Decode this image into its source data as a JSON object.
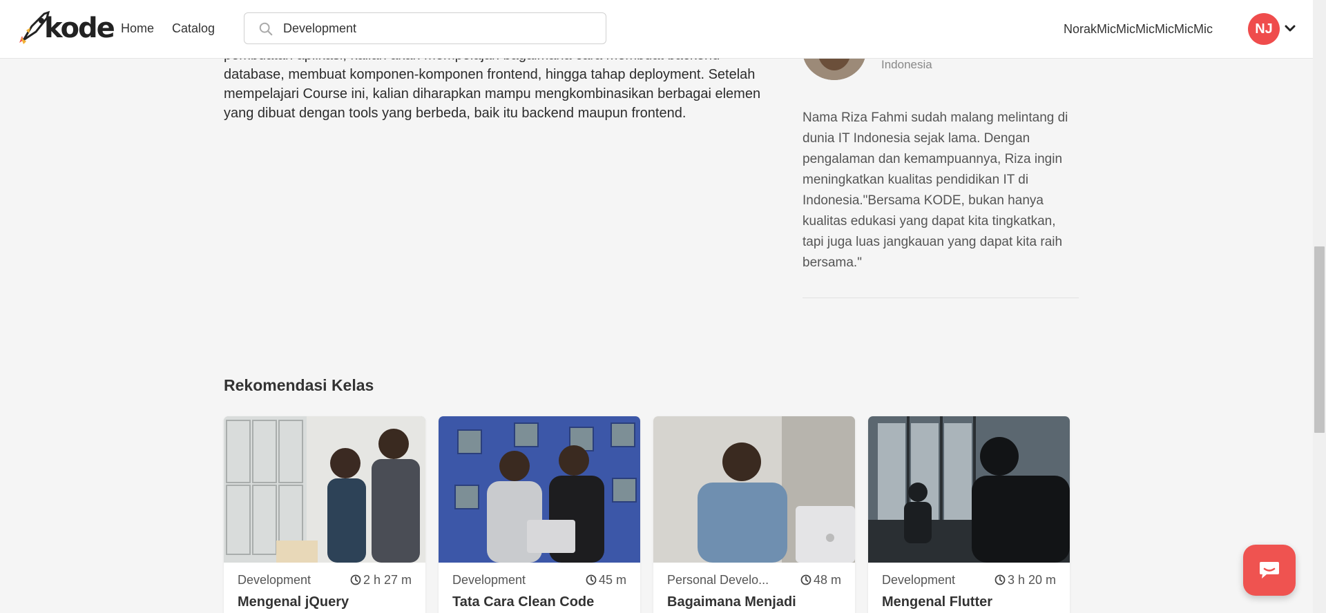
{
  "navbar": {
    "logo_text": "kode",
    "links": [
      {
        "label": "Home"
      },
      {
        "label": "Catalog"
      }
    ],
    "search": {
      "value": "Development",
      "placeholder": "Development"
    },
    "username": "NorakMicMicMicMicMicMic",
    "avatar_initials": "NJ"
  },
  "course": {
    "description": "pembuatan aplikasi, kalian akan mempelajari bagaimana cara membuat backend database, membuat komponen-komponen frontend, hingga tahap deployment. Setelah mempelajari Course ini, kalian diharapkan mampu mengkombinasikan berbagai elemen yang dibuat dengan tools yang berbeda, baik itu backend maupun frontend."
  },
  "instructor": {
    "country": "Indonesia",
    "bio": "Nama Riza Fahmi sudah malang melintang di dunia IT Indonesia sejak lama. Dengan pengalaman dan kemampuannya, Riza ingin meningkatkan kualitas pendidikan IT di Indonesia.\"Bersama KODE, bukan hanya kualitas edukasi yang dapat kita tingkatkan, tapi juga luas jangkauan yang dapat kita raih bersama.\""
  },
  "recommendations": {
    "title": "Rekomendasi Kelas",
    "cards": [
      {
        "category": "Development",
        "duration": "2 h 27 m",
        "title": "Mengenal jQuery"
      },
      {
        "category": "Development",
        "duration": "45 m",
        "title": "Tata Cara Clean Code"
      },
      {
        "category": "Personal Develo...",
        "duration": "48 m",
        "title": "Bagaimana Menjadi"
      },
      {
        "category": "Development",
        "duration": "3 h 20 m",
        "title": "Mengenal Flutter"
      }
    ]
  },
  "colors": {
    "accent": "#ef4c4c",
    "background": "#f5f5f5"
  }
}
